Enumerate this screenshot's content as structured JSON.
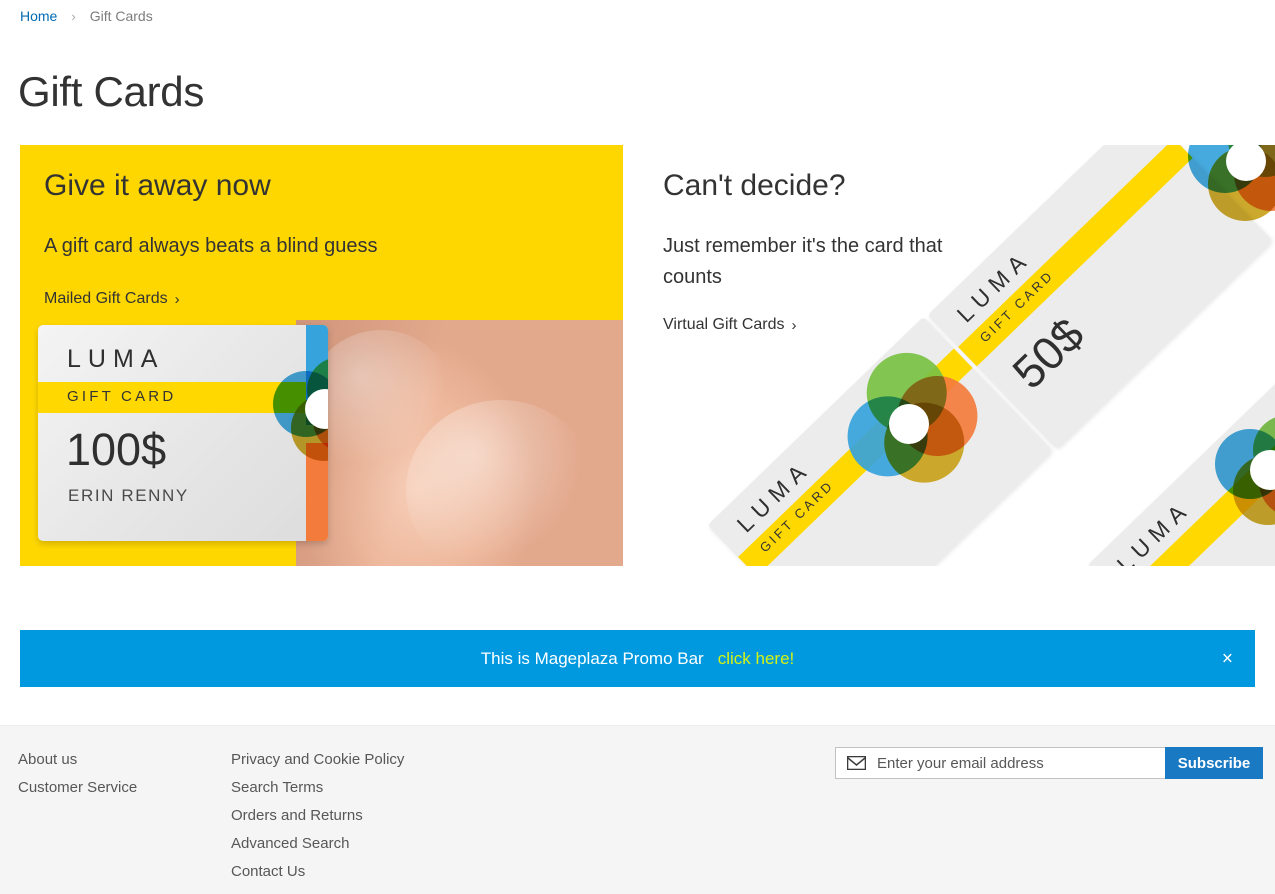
{
  "breadcrumb": {
    "home_label": "Home",
    "separator": "›",
    "current_label": "Gift Cards"
  },
  "page_title": "Gift Cards",
  "blocks": [
    {
      "title": "Give it away now",
      "subtitle": "A gift card always beats a blind guess",
      "link_label": "Mailed Gift Cards",
      "chevron": "›",
      "background_color": "#ffd700",
      "card": {
        "brand": "LUMA",
        "type": "GIFT CARD",
        "amount": "100$",
        "holder": "ERIN RENNY"
      }
    },
    {
      "title": "Can't decide?",
      "subtitle": "Just remember it's the card that counts",
      "link_label": "Virtual Gift Cards",
      "chevron": "›",
      "background_color": "#ffffff",
      "card": {
        "brand": "LUMA",
        "type": "GIFT CARD",
        "amount": "50$"
      }
    }
  ],
  "promo_bar": {
    "text": "This is Mageplaza Promo Bar",
    "link_label": "click here!",
    "close_label": "×",
    "background_color": "#0099e0",
    "link_color": "#d4f214"
  },
  "footer": {
    "column_a": [
      {
        "label": "About us"
      },
      {
        "label": "Customer Service"
      }
    ],
    "column_b": [
      {
        "label": "Privacy and Cookie Policy"
      },
      {
        "label": "Search Terms"
      },
      {
        "label": "Orders and Returns"
      },
      {
        "label": "Advanced Search"
      },
      {
        "label": "Contact Us"
      }
    ],
    "newsletter": {
      "placeholder": "Enter your email address",
      "value": "",
      "button_label": "Subscribe",
      "button_color": "#1979c3"
    }
  }
}
